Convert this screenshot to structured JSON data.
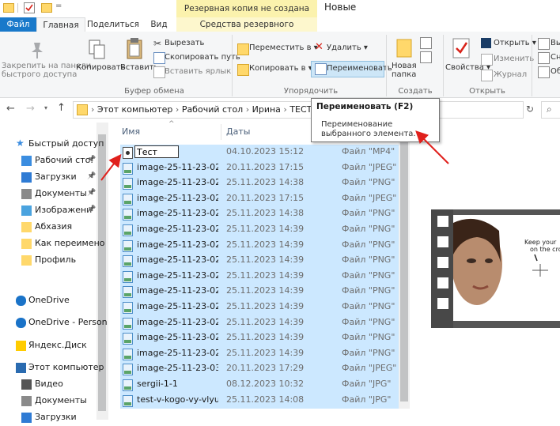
{
  "window": {
    "title": "Новые",
    "context_header": "Резервная копия не создана"
  },
  "tabs": {
    "file": "Файл",
    "home": "Главная",
    "share": "Поделиться",
    "view": "Вид",
    "backup_tools": "Средства резервного копирования"
  },
  "ribbon": {
    "pin_label_1": "Закрепить на панели",
    "pin_label_2": "быстрого доступа",
    "copy": "Копировать",
    "paste": "Вставить",
    "cut": "Вырезать",
    "copy_path": "Скопировать путь",
    "paste_shortcut": "Вставить ярлык",
    "clipboard_group": "Буфер обмена",
    "move_to": "Переместить в",
    "copy_to": "Копировать в",
    "delete": "Удалить",
    "rename": "Переименовать",
    "organize_group": "Упорядочить",
    "new_folder_1": "Новая",
    "new_folder_2": "папка",
    "create_group": "Создать",
    "properties": "Свойства",
    "open": "Открыть",
    "edit": "Изменить",
    "history": "Журнал",
    "open_group": "Открыть",
    "select_1": "Вы",
    "select_2": "Сн",
    "select_3": "Об"
  },
  "address": {
    "path": [
      "Этот компьютер",
      "Рабочий стол",
      "Ирина",
      "ТЕСТЬ"
    ]
  },
  "tooltip": {
    "title": "Переименовать (F2)",
    "desc": "Переименование выбранного элемента."
  },
  "nav": {
    "items": [
      {
        "label": "Быстрый доступ",
        "icon": "star-icon"
      },
      {
        "label": "Рабочий сто.",
        "icon": "desktop-folder-icon",
        "pinned": true
      },
      {
        "label": "Загрузки",
        "icon": "download-arrow-icon",
        "pinned": true
      },
      {
        "label": "Документы",
        "icon": "documents-icon",
        "pinned": true
      },
      {
        "label": "Изображени",
        "icon": "pictures-icon",
        "pinned": true
      },
      {
        "label": "Абхазия",
        "icon": "folder-icon"
      },
      {
        "label": "Как переимено",
        "icon": "folder-icon"
      },
      {
        "label": "Профиль",
        "icon": "folder-icon"
      },
      {
        "label": "OneDrive",
        "icon": "cloud-icon"
      },
      {
        "label": "OneDrive - Person",
        "icon": "cloud-icon"
      },
      {
        "label": "Яндекс.Диск",
        "icon": "yandex-disk-icon"
      },
      {
        "label": "Этот компьютер",
        "icon": "computer-icon"
      },
      {
        "label": "Видео",
        "icon": "video-icon"
      },
      {
        "label": "Документы",
        "icon": "documents-icon"
      },
      {
        "label": "Загрузки",
        "icon": "download-arrow-icon"
      }
    ]
  },
  "list": {
    "col_name": "Имя",
    "col_date": "Даты",
    "rename_value": "Тест",
    "rows": [
      {
        "name": "Тест",
        "date": "04.10.2023 15:12",
        "type": "Файл \"MP4\"",
        "editing": true
      },
      {
        "name": "image-25-11-23-02...",
        "date": "20.11.2023 17:15",
        "type": "Файл \"JPEG\""
      },
      {
        "name": "image-25-11-23-02...",
        "date": "25.11.2023 14:38",
        "type": "Файл \"PNG\""
      },
      {
        "name": "image-25-11-23-02...",
        "date": "20.11.2023 17:15",
        "type": "Файл \"JPEG\""
      },
      {
        "name": "image-25-11-23-02...",
        "date": "25.11.2023 14:38",
        "type": "Файл \"PNG\""
      },
      {
        "name": "image-25-11-23-02...",
        "date": "25.11.2023 14:39",
        "type": "Файл \"PNG\""
      },
      {
        "name": "image-25-11-23-02...",
        "date": "25.11.2023 14:39",
        "type": "Файл \"PNG\""
      },
      {
        "name": "image-25-11-23-02...",
        "date": "25.11.2023 14:39",
        "type": "Файл \"PNG\""
      },
      {
        "name": "image-25-11-23-02...",
        "date": "25.11.2023 14:39",
        "type": "Файл \"PNG\""
      },
      {
        "name": "image-25-11-23-02...",
        "date": "25.11.2023 14:39",
        "type": "Файл \"PNG\""
      },
      {
        "name": "image-25-11-23-02...",
        "date": "25.11.2023 14:39",
        "type": "Файл \"PNG\""
      },
      {
        "name": "image-25-11-23-02...",
        "date": "25.11.2023 14:39",
        "type": "Файл \"PNG\""
      },
      {
        "name": "image-25-11-23-02...",
        "date": "25.11.2023 14:39",
        "type": "Файл \"PNG\""
      },
      {
        "name": "image-25-11-23-02...",
        "date": "25.11.2023 14:39",
        "type": "Файл \"PNG\""
      },
      {
        "name": "image-25-11-23-03...",
        "date": "20.11.2023 17:29",
        "type": "Файл \"JPEG\""
      },
      {
        "name": "sergii-1-1",
        "date": "08.12.2023 10:32",
        "type": "Файл \"JPG\""
      },
      {
        "name": "test-v-kogo-vy-vlyu...",
        "date": "25.11.2023 14:08",
        "type": "Файл \"JPG\""
      }
    ]
  },
  "preview": {
    "caption_1": "Keep your",
    "caption_2": "on the cro"
  },
  "colors": {
    "selection": "#cce8ff",
    "accent": "#1979ca",
    "context_tab": "#fbf2ad",
    "annotation_arrow": "#e0201c"
  }
}
